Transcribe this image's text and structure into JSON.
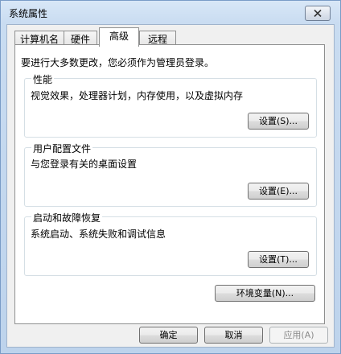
{
  "window": {
    "title": "系统属性"
  },
  "tabs": [
    {
      "label": "计算机名"
    },
    {
      "label": "硬件"
    },
    {
      "label": "高级"
    },
    {
      "label": "远程"
    }
  ],
  "notice": "要进行大多数更改，您必须作为管理员登录。",
  "performance": {
    "label": "性能",
    "description": "视觉效果，处理器计划，内存使用，以及虚拟内存",
    "button": "设置(S)..."
  },
  "user_profiles": {
    "label": "用户配置文件",
    "description": "与您登录有关的桌面设置",
    "button": "设置(E)..."
  },
  "startup_recovery": {
    "label": "启动和故障恢复",
    "description": "系统启动、系统失败和调试信息",
    "button": "设置(T)..."
  },
  "env_button": "环境变量(N)...",
  "footer": {
    "ok": "确定",
    "cancel": "取消",
    "apply": "应用(A)"
  }
}
